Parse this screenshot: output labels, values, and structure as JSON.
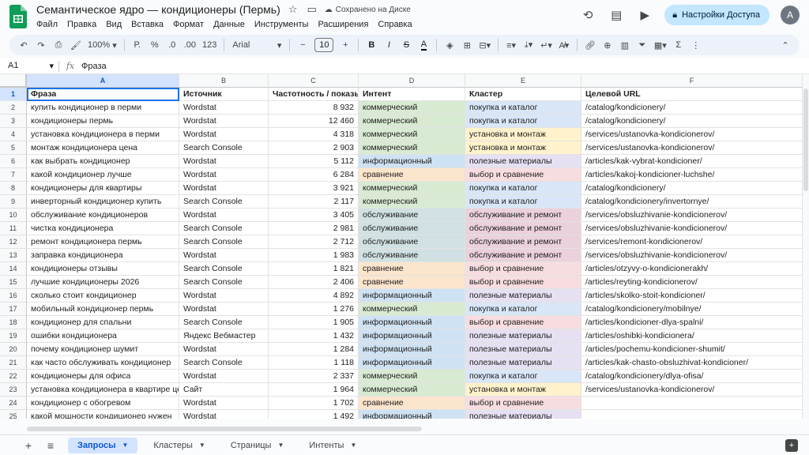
{
  "app": {
    "title": "Семантическое ядро — кондиционеры (Пермь)",
    "saved_status": "Сохранено на Диске",
    "share_label": "Настройки Доступа",
    "avatar_letter": "A"
  },
  "menu": [
    "Файл",
    "Правка",
    "Вид",
    "Вставка",
    "Формат",
    "Данные",
    "Инструменты",
    "Расширения",
    "Справка"
  ],
  "toolbar": {
    "zoom": "100%",
    "currency": "Р.",
    "percent": "%",
    "dec_less": ".0",
    "dec_more": ".00",
    "number_format": "123",
    "font": "Arial",
    "font_size": "10",
    "bold": "B",
    "italic": "I",
    "text_color": "A"
  },
  "formula_bar": {
    "cell_ref": "A1",
    "fx": "fx",
    "content": "Фраза"
  },
  "columns": [
    "A",
    "B",
    "C",
    "D",
    "E",
    "F"
  ],
  "header": [
    "Фраза",
    "Источник",
    "Частотность / показы",
    "Интент",
    "Кластер",
    "Целевой URL"
  ],
  "rows": [
    [
      "купить кондиционер в перми",
      "Wordstat",
      "8 932",
      "коммерческий",
      "покупка и каталог",
      "/catalog/kondicionery/"
    ],
    [
      "кондиционеры пермь",
      "Wordstat",
      "12 460",
      "коммерческий",
      "покупка и каталог",
      "/catalog/kondicionery/"
    ],
    [
      "установка кондиционера в перми",
      "Wordstat",
      "4 318",
      "коммерческий",
      "установка и монтаж",
      "/services/ustanovka-kondicionerov/"
    ],
    [
      "монтаж кондиционера цена",
      "Search Console",
      "2 903",
      "коммерческий",
      "установка и монтаж",
      "/services/ustanovka-kondicionerov/"
    ],
    [
      "как выбрать кондиционер",
      "Wordstat",
      "5 112",
      "информационный",
      "полезные материалы",
      "/articles/kak-vybrat-kondicioner/"
    ],
    [
      "какой кондиционер лучше",
      "Wordstat",
      "6 284",
      "сравнение",
      "выбор и сравнение",
      "/articles/kakoj-kondicioner-luchshe/"
    ],
    [
      "кондиционеры для квартиры",
      "Wordstat",
      "3 921",
      "коммерческий",
      "покупка и каталог",
      "/catalog/kondicionery/"
    ],
    [
      "инверторный кондиционер купить",
      "Search Console",
      "2 117",
      "коммерческий",
      "покупка и каталог",
      "/catalog/kondicionery/invertornye/"
    ],
    [
      "обслуживание кондиционеров",
      "Wordstat",
      "3 405",
      "обслуживание",
      "обслуживание и ремонт",
      "/services/obsluzhivanie-kondicionerov/"
    ],
    [
      "чистка кондиционера",
      "Search Console",
      "2 981",
      "обслуживание",
      "обслуживание и ремонт",
      "/services/obsluzhivanie-kondicionerov/"
    ],
    [
      "ремонт кондиционера пермь",
      "Search Console",
      "2 712",
      "обслуживание",
      "обслуживание и ремонт",
      "/services/remont-kondicionerov/"
    ],
    [
      "заправка кондиционера",
      "Wordstat",
      "1 983",
      "обслуживание",
      "обслуживание и ремонт",
      "/services/obsluzhivanie-kondicionerov/"
    ],
    [
      "кондиционеры отзывы",
      "Search Console",
      "1 821",
      "сравнение",
      "выбор и сравнение",
      "/articles/otzyvy-o-kondicionerakh/"
    ],
    [
      "лучшие кондиционеры 2026",
      "Search Console",
      "2 406",
      "сравнение",
      "выбор и сравнение",
      "/articles/reyting-kondicionerov/"
    ],
    [
      "сколько стоит кондиционер",
      "Wordstat",
      "4 892",
      "информационный",
      "полезные материалы",
      "/articles/skolko-stoit-kondicioner/"
    ],
    [
      "мобильный кондиционер пермь",
      "Wordstat",
      "1 276",
      "коммерческий",
      "покупка и каталог",
      "/catalog/kondicionery/mobilnye/"
    ],
    [
      "кондиционер для спальни",
      "Search Console",
      "1 905",
      "информационный",
      "выбор и сравнение",
      "/articles/kondicioner-dlya-spalni/"
    ],
    [
      "ошибки кондиционера",
      "Яндекс Вебмастер",
      "1 432",
      "информационный",
      "полезные материалы",
      "/articles/oshibki-kondicionera/"
    ],
    [
      "почему кондиционер шумит",
      "Wordstat",
      "1 284",
      "информационный",
      "полезные материалы",
      "/articles/pochemu-kondicioner-shumit/"
    ],
    [
      "как часто обслуживать кондиционер",
      "Search Console",
      "1 118",
      "информационный",
      "полезные материалы",
      "/articles/kak-chasto-obsluzhivat-kondicioner/"
    ],
    [
      "кондиционеры для офиса",
      "Wordstat",
      "2 337",
      "коммерческий",
      "покупка и каталог",
      "/catalog/kondicionery/dlya-ofisa/"
    ],
    [
      "установка кондиционера в квартире цена",
      "Сайт",
      "1 964",
      "коммерческий",
      "установка и монтаж",
      "/services/ustanovka-kondicionerov/"
    ],
    [
      "кондиционер с обогревом",
      "Wordstat",
      "1 702",
      "сравнение",
      "выбор и сравнение",
      ""
    ],
    [
      "какой мощности кондиционер нужен",
      "Wordstat",
      "1 492",
      "информационный",
      "полезные материалы",
      ""
    ]
  ],
  "sheets": [
    {
      "label": "Запросы",
      "active": true
    },
    {
      "label": "Кластеры",
      "active": false
    },
    {
      "label": "Страницы",
      "active": false
    },
    {
      "label": "Интенты",
      "active": false
    }
  ]
}
